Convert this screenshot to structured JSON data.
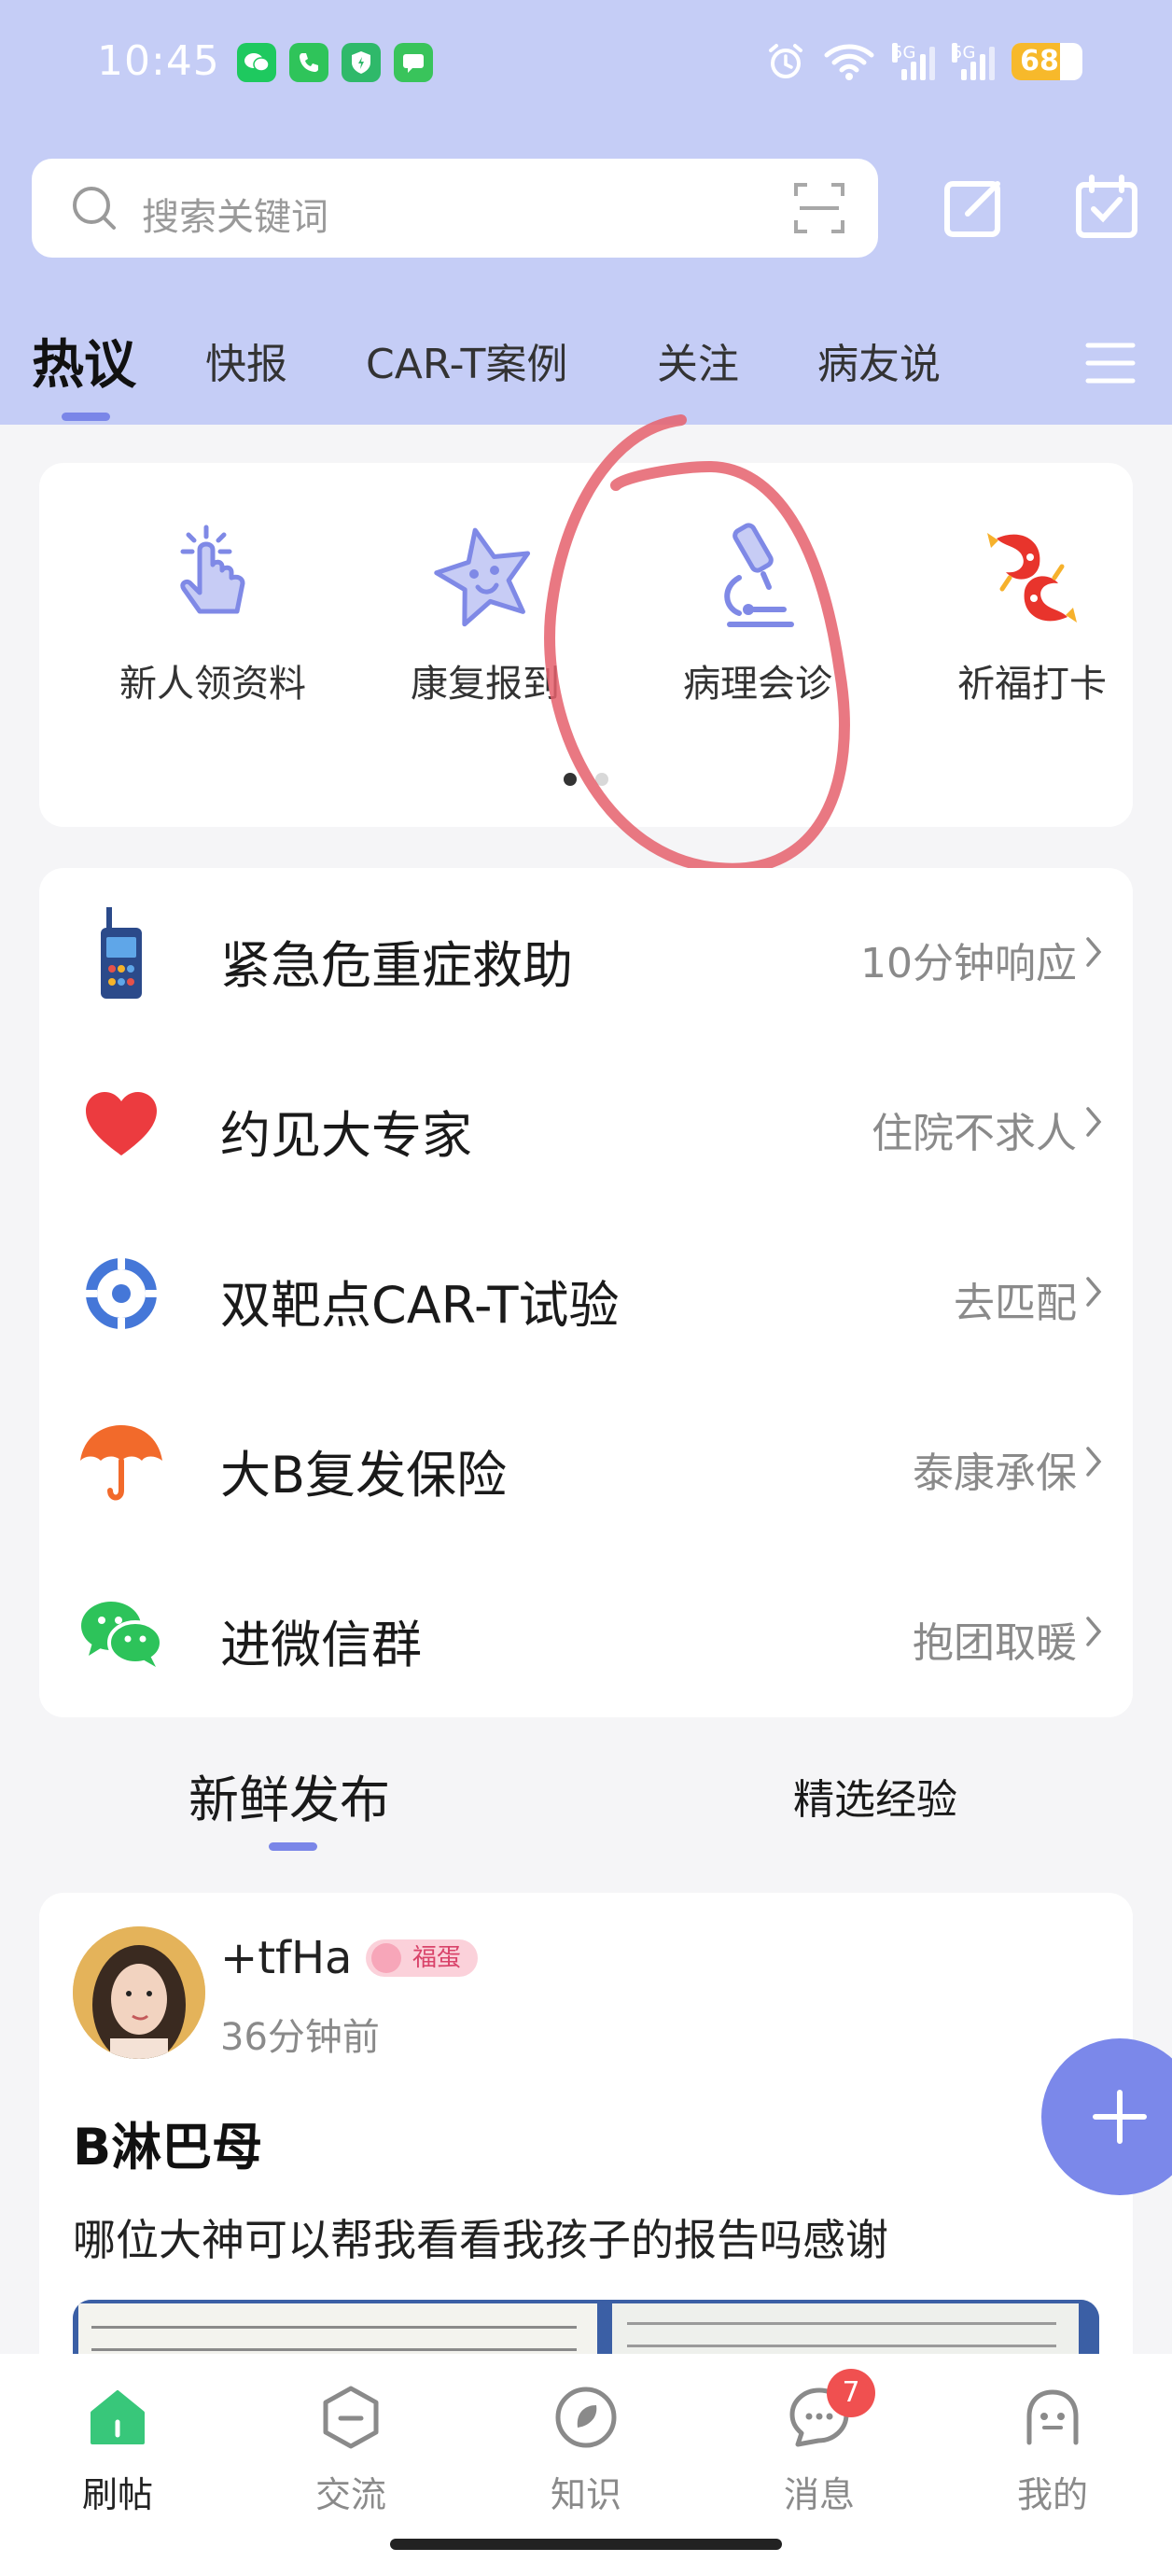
{
  "status_bar": {
    "time": "10:45",
    "signal_labels": [
      "5G",
      "5G"
    ],
    "battery": "68",
    "battery_level": 0.68
  },
  "search": {
    "placeholder": "搜索关键词"
  },
  "top_tabs": [
    "热议",
    "快报",
    "CAR-T案例",
    "关注",
    "病友说"
  ],
  "quick_entries": [
    {
      "label": "新人领资料",
      "icon": "tap-hand-icon"
    },
    {
      "label": "康复报到",
      "icon": "star-face-icon"
    },
    {
      "label": "病理会诊",
      "icon": "microscope-icon"
    },
    {
      "label": "祈福打卡",
      "icon": "koi-fish-icon"
    }
  ],
  "services": [
    {
      "title": "紧急危重症救助",
      "hint": "10分钟响应",
      "icon": "walkie-talkie-icon"
    },
    {
      "title": "约见大专家",
      "hint": "住院不求人",
      "icon": "heart-icon"
    },
    {
      "title": "双靶点CAR-T试验",
      "hint": "去匹配",
      "icon": "target-icon"
    },
    {
      "title": "大B复发保险",
      "hint": "泰康承保",
      "icon": "umbrella-icon"
    },
    {
      "title": "进微信群",
      "hint": "抱团取暖",
      "icon": "wechat-icon"
    }
  ],
  "feed_tabs": {
    "fresh": "新鲜发布",
    "featured": "精选经验"
  },
  "post": {
    "username": "+tfHa",
    "badge": "福蛋",
    "time": "36分钟前",
    "title": "B淋巴母",
    "body": "哪位大神可以帮我看看我孩子的报告吗感谢"
  },
  "bottom_nav": [
    {
      "label": "刷帖",
      "icon": "home-icon"
    },
    {
      "label": "交流",
      "icon": "chat-hex-icon"
    },
    {
      "label": "知识",
      "icon": "knowledge-icon"
    },
    {
      "label": "消息",
      "icon": "message-icon",
      "badge": "7"
    },
    {
      "label": "我的",
      "icon": "profile-icon"
    }
  ],
  "colors": {
    "header_bg": "#c5cdf6",
    "accent": "#7a86e8",
    "annotation": "#e5606c"
  }
}
